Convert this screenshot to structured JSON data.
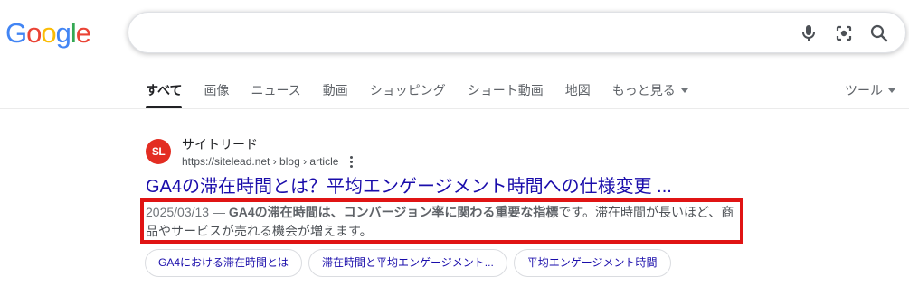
{
  "logo": {
    "letters": [
      "G",
      "o",
      "o",
      "g",
      "l",
      "e"
    ],
    "colors": [
      "#4285F4",
      "#EA4335",
      "#FBBC05",
      "#4285F4",
      "#34A853",
      "#EA4335"
    ]
  },
  "search": {
    "value": "",
    "placeholder": "",
    "icons": [
      "microphone-icon",
      "camera-lens-icon",
      "search-icon"
    ]
  },
  "tabs": [
    {
      "label": "すべて",
      "active": true
    },
    {
      "label": "画像"
    },
    {
      "label": "ニュース"
    },
    {
      "label": "動画"
    },
    {
      "label": "ショッピング"
    },
    {
      "label": "ショート動画"
    },
    {
      "label": "地図"
    },
    {
      "label": "もっと見る",
      "dropdown": true
    }
  ],
  "tools_label": "ツール",
  "result": {
    "favicon_text": "SL",
    "favicon_color": "#e32d22",
    "site_name": "サイトリード",
    "url": "https://sitelead.net › blog › article",
    "title": "GA4の滞在時間とは？平均エンゲージメント時間への仕様変更 ...",
    "snippet_date": "2025/03/13 — ",
    "snippet_bold": "GA4の滞在時間は、コンバージョン率に関わる重要な指標",
    "snippet_rest": "です。滞在時間が長いほど、商品やサービスが売れる機会が増えます。",
    "highlight_color": "#e01414"
  },
  "related_chips": [
    "GA4における滞在時間とは",
    "滞在時間と平均エンゲージメント...",
    "平均エンゲージメント時間"
  ]
}
